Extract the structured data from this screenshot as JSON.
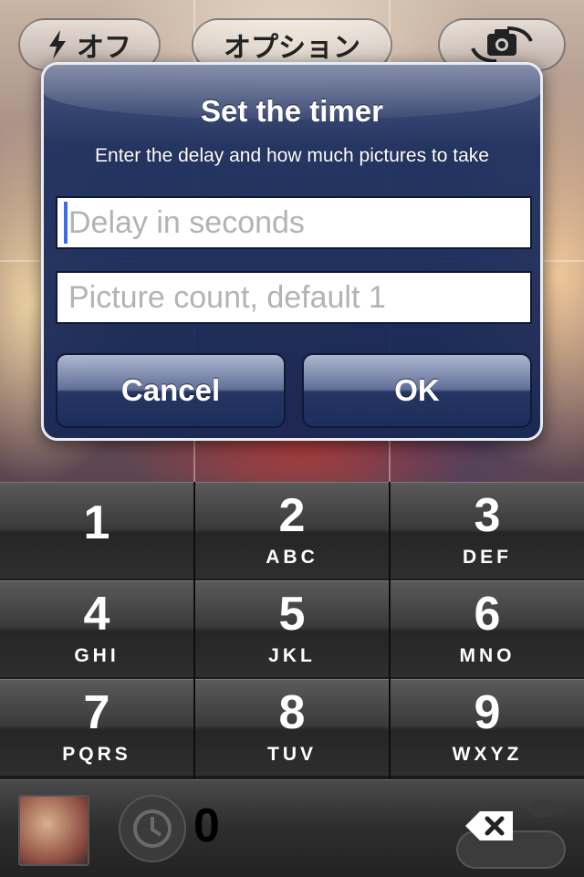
{
  "camera_toolbar": {
    "flash_label": "オフ",
    "options_label": "オプション",
    "flash_icon": "lightning-icon",
    "switch_camera_icon": "camera-switch-icon"
  },
  "alert": {
    "title": "Set the timer",
    "message": "Enter the delay and how much pictures to take",
    "delay_placeholder": "Delay in seconds",
    "count_placeholder": "Picture count, default 1",
    "cancel_label": "Cancel",
    "ok_label": "OK"
  },
  "keypad": {
    "keys": [
      {
        "num": "1",
        "letters": ""
      },
      {
        "num": "2",
        "letters": "ABC"
      },
      {
        "num": "3",
        "letters": "DEF"
      },
      {
        "num": "4",
        "letters": "GHI"
      },
      {
        "num": "5",
        "letters": "JKL"
      },
      {
        "num": "6",
        "letters": "MNO"
      },
      {
        "num": "7",
        "letters": "PQRS"
      },
      {
        "num": "8",
        "letters": "TUV"
      },
      {
        "num": "9",
        "letters": "WXYZ"
      }
    ],
    "zero": "0",
    "backspace_icon": "backspace-icon"
  },
  "bottom_bar": {
    "thumbnail": "photo-thumbnail",
    "timer_icon": "clock-icon",
    "video_icon": "video-camera-icon"
  }
}
